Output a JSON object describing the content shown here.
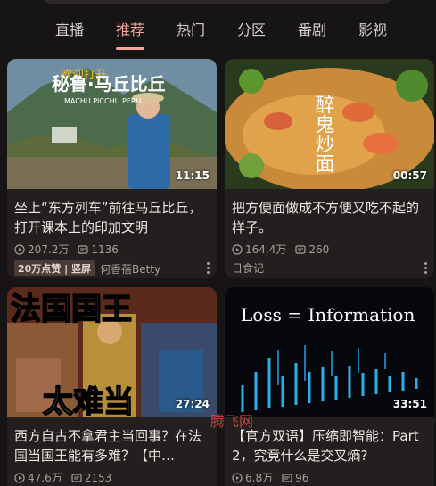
{
  "tabs": [
    "直播",
    "推荐",
    "热门",
    "分区",
    "番剧",
    "影视"
  ],
  "active_tab": "推荐",
  "accent_color": "#f3a79a",
  "cards": [
    {
      "thumb_line1": "欢迎打开",
      "thumb_line2": "秘鲁·马丘比丘",
      "thumb_line3": "MACHU PICCHU PERU",
      "duration": "11:15",
      "title": "坐上“东方列车”前往马丘比丘，打开课本上的印加文明",
      "views": "207.2万",
      "danmaku": "1136",
      "badge": "20万点赞 | 竖屏",
      "author": "何香蓓Betty"
    },
    {
      "thumb_text": "醉鬼炒面",
      "duration": "00:57",
      "title": "把方便面做成不方便又吃不起的样子。",
      "views": "164.4万",
      "danmaku": "260",
      "author": "日食记"
    },
    {
      "thumb_line1": "法国国王",
      "thumb_line2": "太难当",
      "duration": "27:24",
      "title": "西方自古不拿君主当回事？在法国当国王能有多难？【中…",
      "views": "47.6万",
      "danmaku": "2153"
    },
    {
      "thumb_text": "Loss = Information",
      "duration": "33:51",
      "title": "【官方双语】压缩即智能：Part 2，究竟什么是交叉熵?",
      "views": "6.8万",
      "danmaku": "96"
    }
  ],
  "watermark": "腾飞网"
}
